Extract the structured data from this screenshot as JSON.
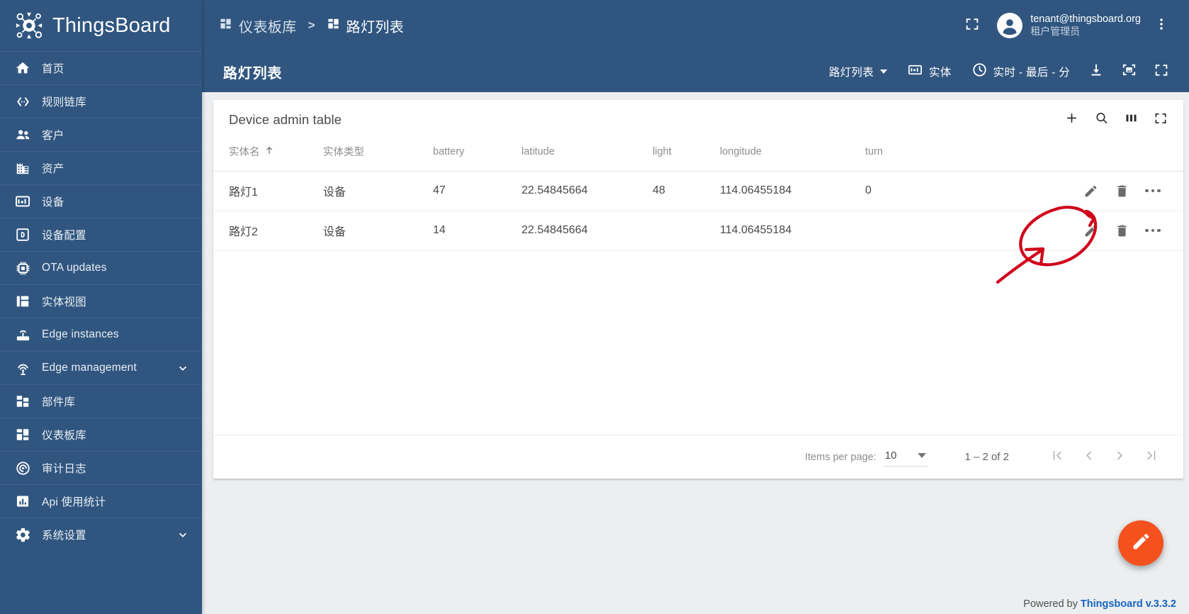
{
  "brand": {
    "name": "ThingsBoard",
    "logo_icon": "thingsboard-logo-icon"
  },
  "sidebar": {
    "items": [
      {
        "label": "首页",
        "icon": "home-icon",
        "expandable": false
      },
      {
        "label": "规则链库",
        "icon": "rule-chain-icon",
        "expandable": false
      },
      {
        "label": "客户",
        "icon": "customers-icon",
        "expandable": false
      },
      {
        "label": "资产",
        "icon": "assets-icon",
        "expandable": false
      },
      {
        "label": "设备",
        "icon": "devices-icon",
        "expandable": false
      },
      {
        "label": "设备配置",
        "icon": "device-profile-icon",
        "expandable": false
      },
      {
        "label": "OTA updates",
        "icon": "ota-updates-icon",
        "expandable": false
      },
      {
        "label": "实体视图",
        "icon": "entity-view-icon",
        "expandable": false
      },
      {
        "label": "Edge instances",
        "icon": "router-icon",
        "expandable": false
      },
      {
        "label": "Edge management",
        "icon": "edge-management-icon",
        "expandable": true
      },
      {
        "label": "部件库",
        "icon": "widgets-icon",
        "expandable": false
      },
      {
        "label": "仪表板库",
        "icon": "dashboards-icon",
        "expandable": false
      },
      {
        "label": "审计日志",
        "icon": "audit-log-icon",
        "expandable": false
      },
      {
        "label": "Api 使用统计",
        "icon": "api-usage-icon",
        "expandable": false
      },
      {
        "label": "系统设置",
        "icon": "settings-gear-icon",
        "expandable": true
      }
    ]
  },
  "topbar": {
    "breadcrumb": [
      {
        "label": "仪表板库",
        "icon": "dashboards-icon"
      },
      {
        "label": "路灯列表",
        "icon": "dashboards-icon"
      }
    ],
    "breadcrumb_separator": ">",
    "fullscreen_icon": "fullscreen-icon",
    "user": {
      "avatar_icon": "account-circle-icon",
      "email": "tenant@thingsboard.org",
      "role": "租户管理员"
    },
    "more_icon": "more-vertical-icon"
  },
  "dashboard_toolbar": {
    "title": "路灯列表",
    "state_selector": {
      "label": "路灯列表",
      "icon": "chevron-down-icon"
    },
    "entity_button": {
      "label": "实体",
      "icon": "entity-alias-icon"
    },
    "timewindow_button": {
      "label": "实时 - 最后 - 分",
      "icon": "clock-icon"
    },
    "export_icon": "download-icon",
    "image_icon": "image-export-icon",
    "fullscreen_icon": "fullscreen-icon"
  },
  "widget": {
    "title": "Device admin table",
    "header_actions": [
      {
        "name": "add-entity-button",
        "icon": "plus-icon"
      },
      {
        "name": "search-button",
        "icon": "search-icon"
      },
      {
        "name": "column-display-button",
        "icon": "columns-icon"
      },
      {
        "name": "fullscreen-button",
        "icon": "fullscreen-icon"
      }
    ],
    "table": {
      "columns": [
        {
          "key": "name",
          "label": "实体名",
          "sorted": true,
          "sort_icon": "arrow-up-icon"
        },
        {
          "key": "type",
          "label": "实体类型",
          "sorted": false
        },
        {
          "key": "battery",
          "label": "battery",
          "sorted": false
        },
        {
          "key": "latitude",
          "label": "latitude",
          "sorted": false
        },
        {
          "key": "light",
          "label": "light",
          "sorted": false
        },
        {
          "key": "longitude",
          "label": "longitude",
          "sorted": false
        },
        {
          "key": "turn",
          "label": "turn",
          "sorted": false
        }
      ],
      "rows": [
        {
          "name": "路灯1",
          "type": "设备",
          "battery": "47",
          "latitude": "22.54845664",
          "light": "48",
          "longitude": "114.06455184",
          "turn": "0"
        },
        {
          "name": "路灯2",
          "type": "设备",
          "battery": "14",
          "latitude": "22.54845664",
          "light": "",
          "longitude": "114.06455184",
          "turn": ""
        }
      ],
      "row_actions": [
        {
          "name": "edit-row-button",
          "icon": "pencil-icon"
        },
        {
          "name": "delete-row-button",
          "icon": "trash-icon"
        },
        {
          "name": "row-more-button",
          "icon": "more-horizontal-icon"
        }
      ]
    },
    "paginator": {
      "items_per_page_label": "Items per page:",
      "items_per_page_value": "10",
      "range_label": "1 – 2 of 2",
      "buttons": [
        {
          "name": "first-page-button",
          "icon": "first-page-icon"
        },
        {
          "name": "previous-page-button",
          "icon": "chevron-left-icon"
        },
        {
          "name": "next-page-button",
          "icon": "chevron-right-icon"
        },
        {
          "name": "last-page-button",
          "icon": "last-page-icon"
        }
      ]
    }
  },
  "fab": {
    "icon": "pencil-icon"
  },
  "footer": {
    "powered_by": "Powered by ",
    "link": "Thingsboard v.3.3.2"
  },
  "annotation": {
    "type": "hand-drawn-red-marker",
    "color": "#d0021b",
    "shapes": [
      "oval-around-row-more-button",
      "arrow-pointing-to-row-more-button"
    ]
  },
  "colors": {
    "sidebar_bg": "#305680",
    "topbar_bg": "#305680",
    "canvas_bg": "#eceef0",
    "card_bg": "#ffffff",
    "fab": "#f4511e",
    "link": "#1565c0",
    "annotation_red": "#d0021b"
  }
}
